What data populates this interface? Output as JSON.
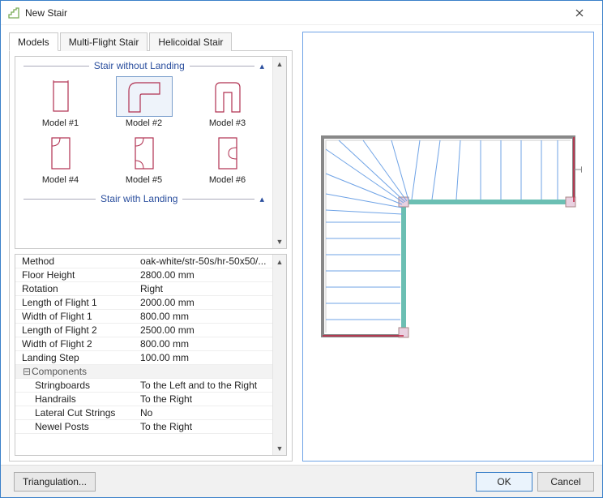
{
  "window": {
    "title": "New Stair"
  },
  "tabs": {
    "models": "Models",
    "multi": "Multi-Flight Stair",
    "helicoidal": "Helicoidal Stair"
  },
  "sections": {
    "without_landing": "Stair without Landing",
    "with_landing": "Stair with Landing"
  },
  "models": {
    "m1": "Model #1",
    "m2": "Model #2",
    "m3": "Model #3",
    "m4": "Model #4",
    "m5": "Model #5",
    "m6": "Model #6"
  },
  "props": {
    "method_k": "Method",
    "method_v": "oak-white/str-50s/hr-50x50/...",
    "floorh_k": "Floor Height",
    "floorh_v": "2800.00 mm",
    "rot_k": "Rotation",
    "rot_v": "Right",
    "lf1_k": "Length of Flight 1",
    "lf1_v": "2000.00 mm",
    "wf1_k": "Width of Flight 1",
    "wf1_v": "800.00 mm",
    "lf2_k": "Length of Flight 2",
    "lf2_v": "2500.00 mm",
    "wf2_k": "Width of Flight 2",
    "wf2_v": "800.00 mm",
    "land_k": "Landing Step",
    "land_v": "100.00 mm",
    "components": "Components",
    "sb_k": "Stringboards",
    "sb_v": "To the Left and to the Right",
    "hr_k": "Handrails",
    "hr_v": "To the Right",
    "lcs_k": "Lateral Cut Strings",
    "lcs_v": "No",
    "np_k": "Newel Posts",
    "np_v": "To the Right"
  },
  "footer": {
    "triangulation": "Triangulation...",
    "ok": "OK",
    "cancel": "Cancel"
  }
}
